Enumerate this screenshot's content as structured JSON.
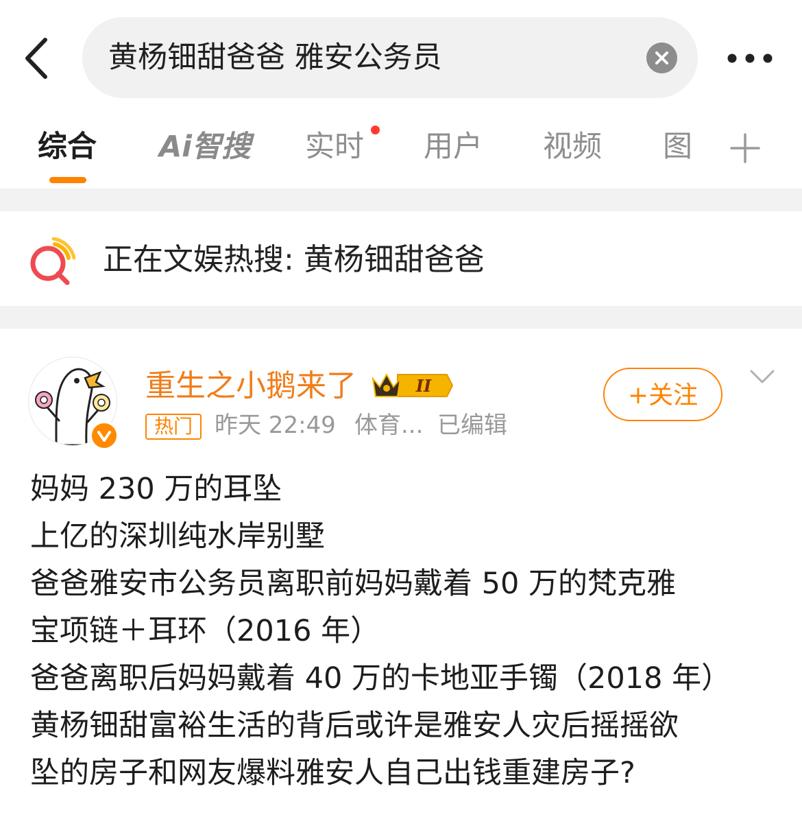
{
  "search": {
    "query": "黄杨钿甜爸爸 雅安公务员"
  },
  "tabs": [
    {
      "label": "综合"
    },
    {
      "label": "Ai智搜"
    },
    {
      "label": "实时"
    },
    {
      "label": "用户"
    },
    {
      "label": "视频"
    },
    {
      "label": "图"
    }
  ],
  "hot_banner": {
    "text": "正在文娱热搜: 黄杨钿甜爸爸"
  },
  "post": {
    "username": "重生之小鹅来了",
    "rank_badge": "II",
    "hot_tag": "热门",
    "time": "昨天 22:49",
    "source": "体育...",
    "edited": "已编辑",
    "follow_label": "+关注",
    "lines": [
      "妈妈 230 万的耳坠",
      "上亿的深圳纯水岸别墅",
      "爸爸雅安市公务员离职前妈妈戴着 50 万的梵克雅",
      "宝项链＋耳环（2016 年）",
      "爸爸离职后妈妈戴着 40 万的卡地亚手镯（2018 年）",
      "黄杨钿甜富裕生活的背后或许是雅安人灾后摇摇欲",
      "坠的房子和网友爆料雅安人自己出钱重建房子?"
    ]
  },
  "colors": {
    "accent": "#ff8200",
    "username": "#f07d1a",
    "notification_dot": "#ff3b30"
  }
}
